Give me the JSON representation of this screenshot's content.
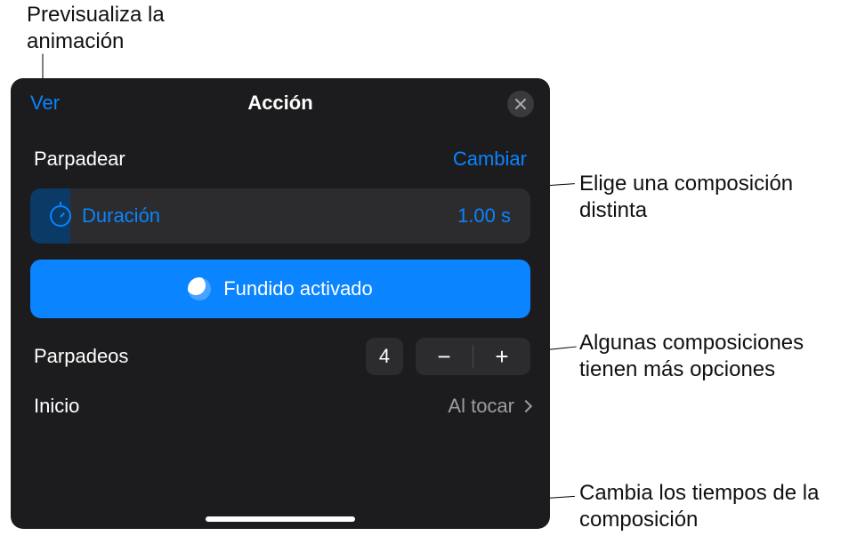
{
  "annotations": {
    "top": "Previsualiza la animación",
    "change": "Elige una composición distinta",
    "options": "Algunas composiciones tienen más opciones",
    "timing": "Cambia los tiempos de la composición"
  },
  "panel": {
    "header": {
      "preview": "Ver",
      "title": "Acción"
    },
    "effect": {
      "name": "Parpadear",
      "change_label": "Cambiar"
    },
    "duration": {
      "label": "Duración",
      "value": "1.00 s"
    },
    "option_button": {
      "label": "Fundido activado"
    },
    "count": {
      "label": "Parpadeos",
      "value": "4",
      "minus": "−",
      "plus": "+"
    },
    "start": {
      "label": "Inicio",
      "value": "Al tocar"
    }
  },
  "colors": {
    "accent": "#0a84ff",
    "panel_bg": "#1c1c1e",
    "card_bg": "#2c2c2e",
    "muted": "#9d9da1"
  }
}
